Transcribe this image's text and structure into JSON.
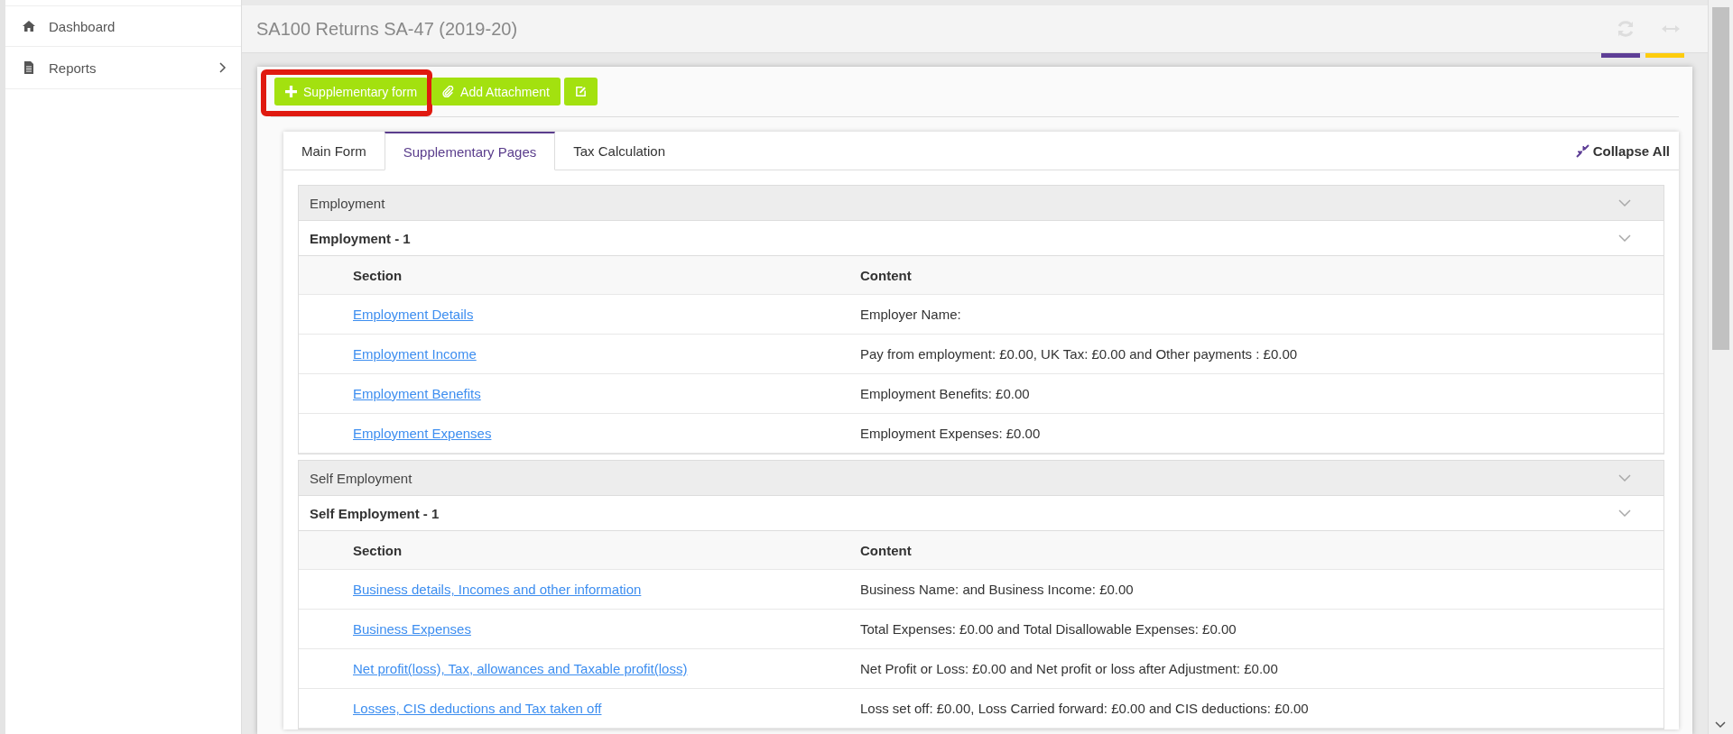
{
  "sidebar": {
    "items": [
      {
        "label": "Dashboard",
        "kind": "home",
        "has_submenu": false
      },
      {
        "label": "Reports",
        "kind": "file",
        "has_submenu": true
      }
    ]
  },
  "header": {
    "title": "SA100 Returns SA-47 (2019-20)"
  },
  "toolbar": {
    "buttons": [
      {
        "kind": "plus",
        "label": "Supplementary form",
        "highlighted": true
      },
      {
        "kind": "paperclip",
        "label": "Add Attachment",
        "highlighted": false
      },
      {
        "kind": "edit",
        "highlighted": false
      }
    ]
  },
  "tabs": [
    {
      "label": "Main Form",
      "selected": false
    },
    {
      "label": "Supplementary Pages",
      "selected": true
    },
    {
      "label": "Tax Calculation",
      "selected": false
    }
  ],
  "collapse_all": {
    "label": "Collapse All"
  },
  "groups": [
    {
      "title": "Employment",
      "entries": [
        {
          "title": "Employment - 1",
          "columns": [
            "Section",
            "Content"
          ],
          "rows": [
            {
              "section": "Employment Details",
              "content": "Employer Name:"
            },
            {
              "section": "Employment Income",
              "content": "Pay from employment: £0.00, UK Tax: £0.00 and Other payments : £0.00"
            },
            {
              "section": "Employment Benefits",
              "content": "Employment Benefits: £0.00"
            },
            {
              "section": "Employment Expenses",
              "content": "Employment Expenses: £0.00"
            }
          ]
        }
      ]
    },
    {
      "title": "Self Employment",
      "entries": [
        {
          "title": "Self Employment - 1",
          "columns": [
            "Section",
            "Content"
          ],
          "rows": [
            {
              "section": "Business details, Incomes and other information",
              "content": "Business Name: and Business Income: £0.00"
            },
            {
              "section": "Business Expenses",
              "content": "Total Expenses: £0.00 and Total Disallowable Expenses: £0.00"
            },
            {
              "section": "Net profit(loss), Tax, allowances and Taxable profit(loss)",
              "content": "Net Profit or Loss: £0.00 and Net profit or loss after Adjustment: £0.00"
            },
            {
              "section": "Losses, CIS deductions and Tax taken off",
              "content": "Loss set off: £0.00, Loss Carried forward: £0.00 and CIS deductions: £0.00"
            }
          ]
        }
      ]
    }
  ]
}
